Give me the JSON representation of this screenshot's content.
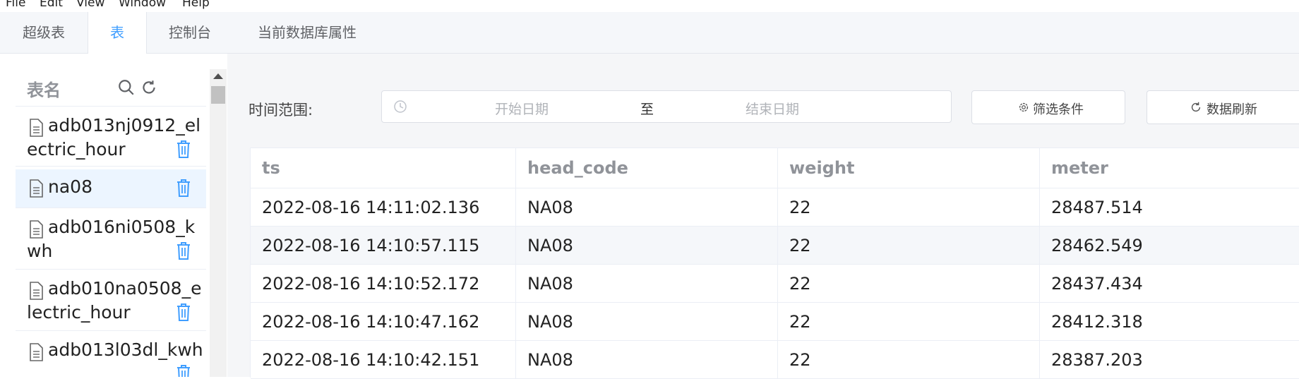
{
  "menu": [
    "File",
    "Edit",
    "View",
    "Window",
    "Help"
  ],
  "tabs": [
    {
      "label": "超级表",
      "active": false
    },
    {
      "label": "表",
      "active": true
    },
    {
      "label": "控制台",
      "active": false
    },
    {
      "label": "当前数据库属性",
      "active": false
    }
  ],
  "sidebar": {
    "header": "表名",
    "items": [
      {
        "name": "adb013nj0912_electric_hour",
        "selected": false
      },
      {
        "name": "na08",
        "selected": true
      },
      {
        "name": "adb016ni0508_kwh",
        "selected": false
      },
      {
        "name": "adb010na0508_electric_hour",
        "selected": false
      },
      {
        "name": "adb013l03dl_kwh",
        "selected": false
      }
    ]
  },
  "filter": {
    "time_label": "时间范围:",
    "start_placeholder": "开始日期",
    "separator": "至",
    "end_placeholder": "结束日期",
    "filter_button": "筛选条件",
    "refresh_button": "数据刷新"
  },
  "table": {
    "columns": [
      "ts",
      "head_code",
      "weight",
      "meter"
    ],
    "rows": [
      [
        "2022-08-16 14:11:02.136",
        "NA08",
        "22",
        "28487.514"
      ],
      [
        "2022-08-16 14:10:57.115",
        "NA08",
        "22",
        "28462.549"
      ],
      [
        "2022-08-16 14:10:52.172",
        "NA08",
        "22",
        "28437.434"
      ],
      [
        "2022-08-16 14:10:47.162",
        "NA08",
        "22",
        "28412.318"
      ],
      [
        "2022-08-16 14:10:42.151",
        "NA08",
        "22",
        "28387.203"
      ]
    ]
  },
  "colors": {
    "accent": "#409eff",
    "selected_bg": "#ecf5ff",
    "header_text": "#909399"
  }
}
